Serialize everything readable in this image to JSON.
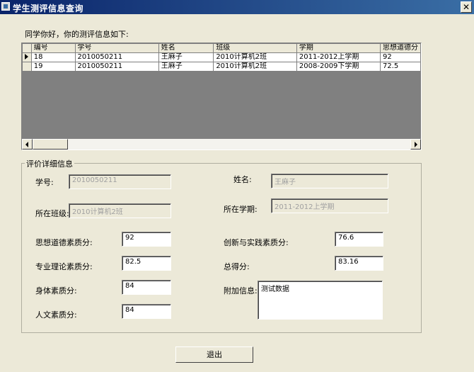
{
  "window": {
    "title": "学生测评信息查询",
    "close_glyph": "✕"
  },
  "greeting": "同学你好，你的测评信息如下:",
  "grid": {
    "columns": [
      "编号",
      "学号",
      "姓名",
      "班级",
      "学期",
      "思想道德分"
    ],
    "rows": [
      [
        "18",
        "2010050211",
        "王麻子",
        "2010计算机2班",
        "2011-2012上学期",
        "92"
      ],
      [
        "19",
        "2010050211",
        "王麻子",
        "2010计算机2班",
        "2008-2009下学期",
        "72.5"
      ]
    ]
  },
  "detail": {
    "group_title": "评价详细信息",
    "student_id_label": "学号:",
    "student_id": "2010050211",
    "name_label": "姓名:",
    "name": "王麻子",
    "class_label": "所在班级:",
    "class": "2010计算机2班",
    "term_label": "所在学期:",
    "term": "2011-2012上学期",
    "moral_label": "思想道德素质分:",
    "moral": "92",
    "innovation_label": "创新与实践素质分:",
    "innovation": "76.6",
    "theory_label": "专业理论素质分:",
    "theory": "82.5",
    "total_label": "总得分:",
    "total": "83.16",
    "physical_label": "身体素质分:",
    "physical": "84",
    "extra_label": "附加信息:",
    "extra": "测试数据",
    "humanities_label": "人文素质分:",
    "humanities": "84"
  },
  "exit_button": "退出"
}
